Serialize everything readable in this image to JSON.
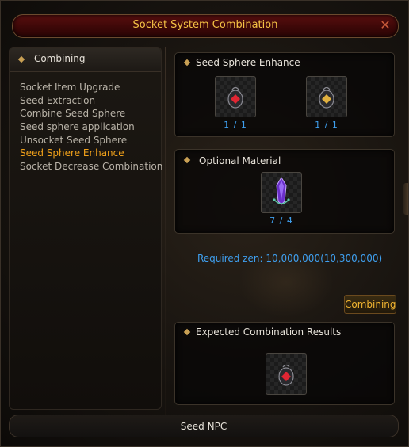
{
  "window": {
    "title": "Socket System Combination",
    "close_icon": "close-x-icon"
  },
  "left_panel": {
    "header_label": "Combining",
    "items": [
      {
        "label": "Socket Item Upgrade",
        "active": false
      },
      {
        "label": "Seed Extraction",
        "active": false
      },
      {
        "label": "Combine Seed Sphere",
        "active": false
      },
      {
        "label": "Seed sphere application",
        "active": false
      },
      {
        "label": "Unsocket Seed Sphere",
        "active": false
      },
      {
        "label": "Seed Sphere Enhance",
        "active": true
      },
      {
        "label": "Socket Decrease Combination",
        "active": false
      }
    ]
  },
  "enhance": {
    "title": "Seed Sphere Enhance",
    "slots": [
      {
        "icon": "red-seed-sphere-icon",
        "count": "1 / 1"
      },
      {
        "icon": "gold-seed-sphere-icon",
        "count": "1 / 1"
      }
    ]
  },
  "optional_material": {
    "title": "Optional Material",
    "slots": [
      {
        "icon": "purple-crystal-icon",
        "count": "7 / 4"
      }
    ]
  },
  "required_zen": "Required zen: 10,000,000(10,300,000)",
  "combine_button": "Combining",
  "results": {
    "title": "Expected Combination Results",
    "slot": {
      "icon": "red-seed-sphere-icon"
    }
  },
  "footer": {
    "label": "Seed NPC"
  },
  "colors": {
    "accent_gold": "#f5c245",
    "active_orange": "#f2a21a",
    "count_blue": "#3fa0f0",
    "title_red": "#5a0f0f"
  }
}
